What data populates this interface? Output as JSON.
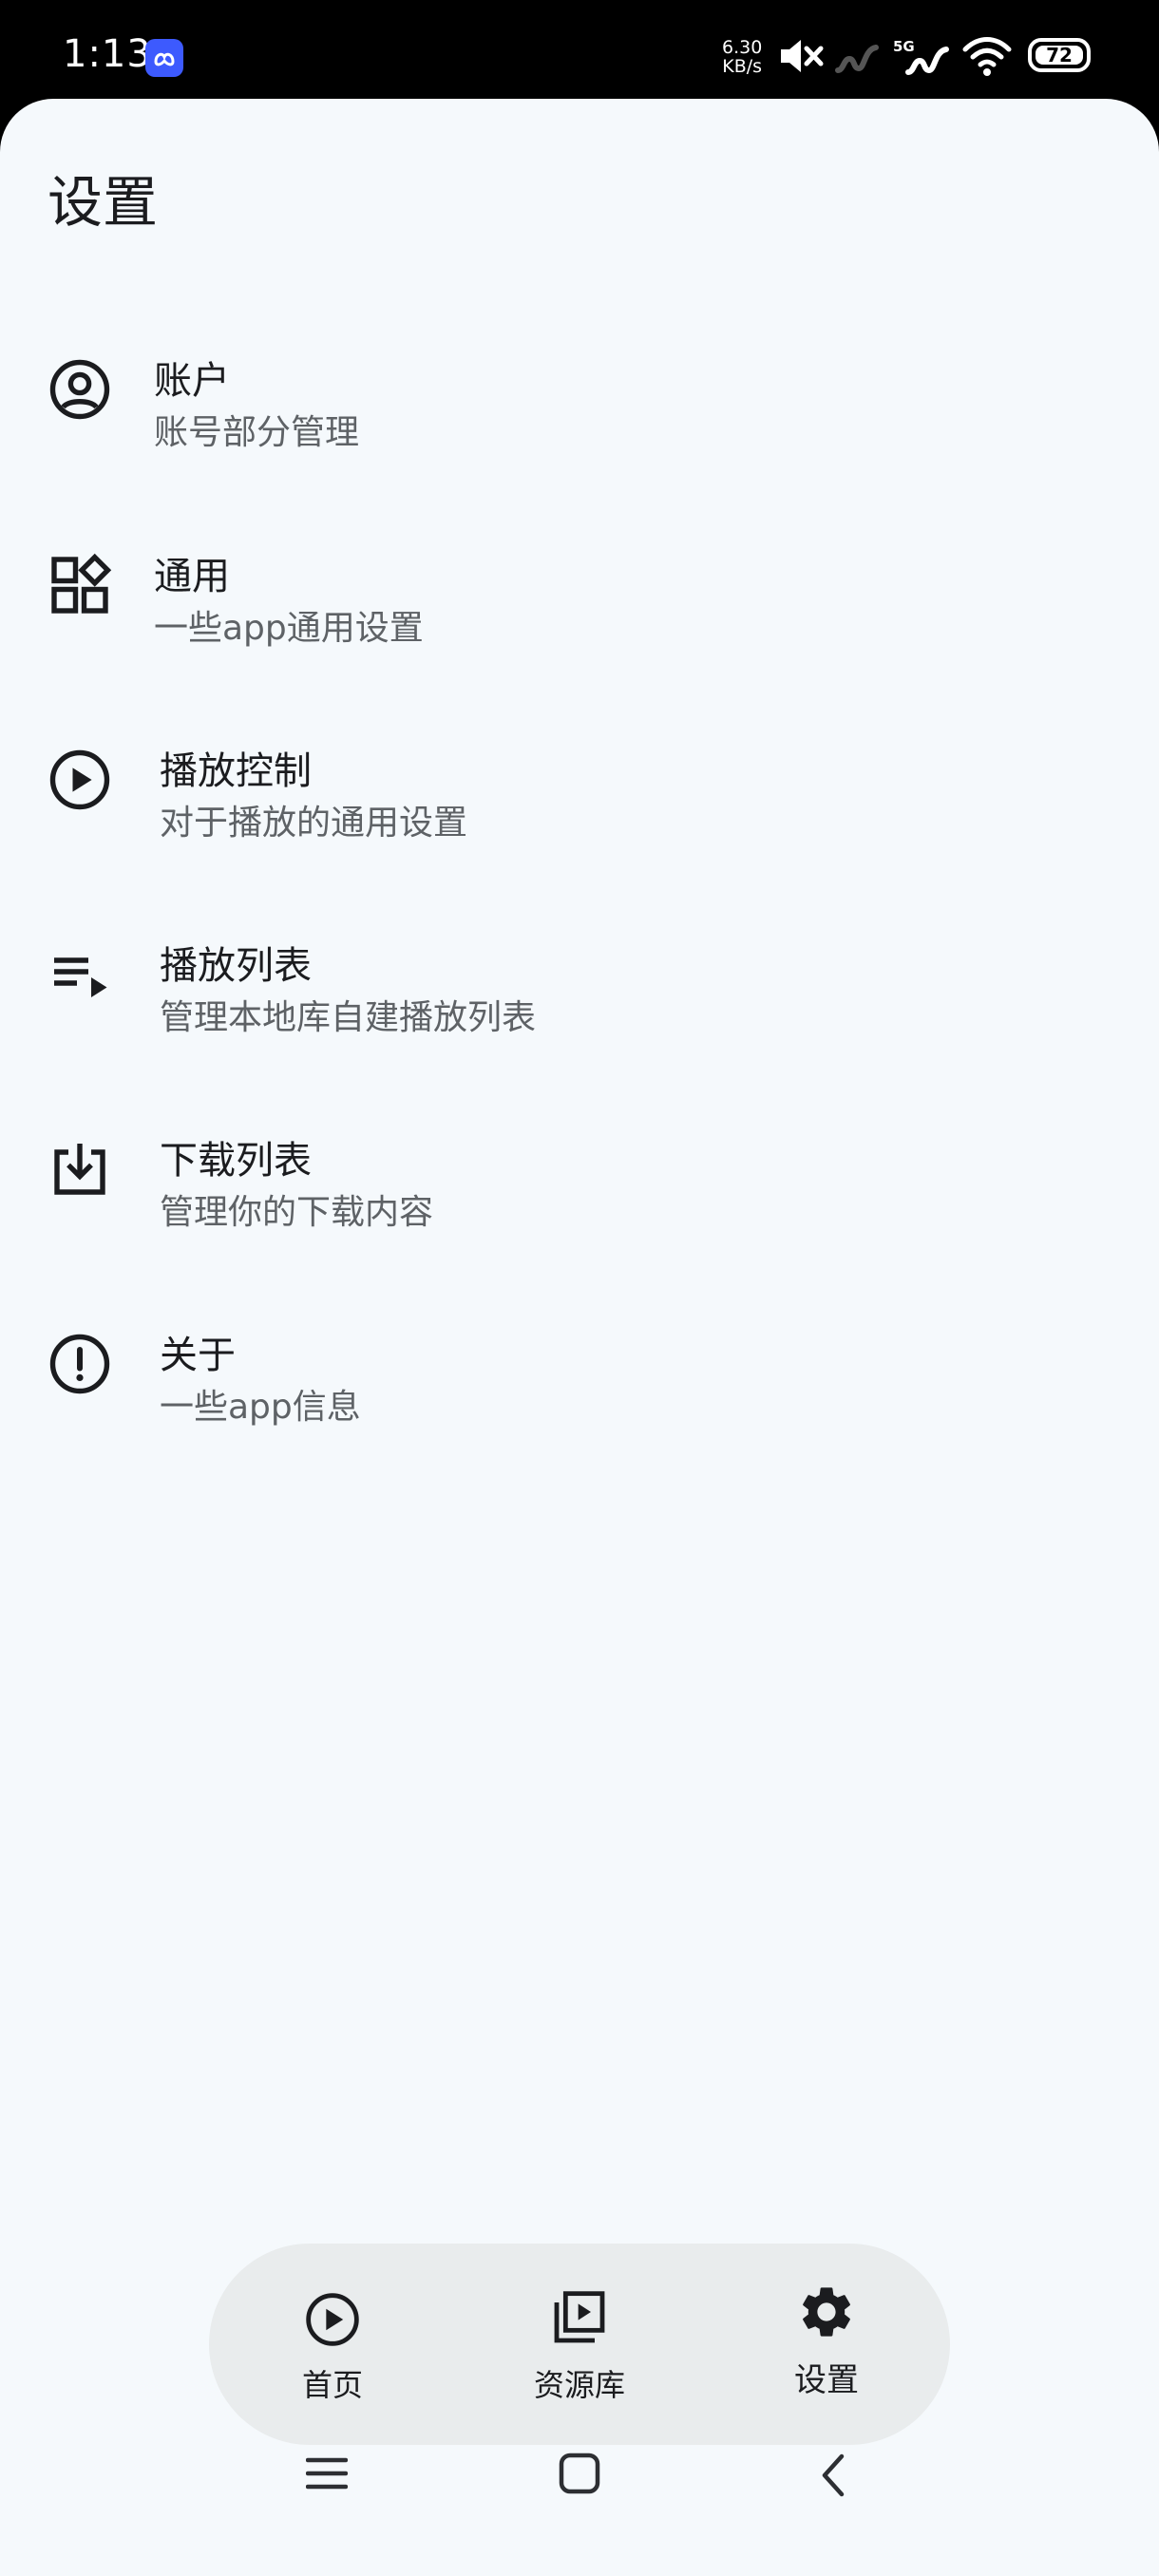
{
  "status_bar": {
    "time": "1:13",
    "speed_value": "6.30",
    "speed_unit": "KB/s",
    "signal_label": "5G",
    "battery": "72"
  },
  "page": {
    "title": "设置"
  },
  "settings": [
    {
      "title": "账户",
      "subtitle": "账号部分管理",
      "icon": "account-circle-icon"
    },
    {
      "title": "通用",
      "subtitle": "一些app通用设置",
      "icon": "widgets-icon"
    },
    {
      "title": "播放控制",
      "subtitle": "对于播放的通用设置",
      "icon": "play-circle-icon"
    },
    {
      "title": "播放列表",
      "subtitle": "管理本地库自建播放列表",
      "icon": "playlist-play-icon"
    },
    {
      "title": "下载列表",
      "subtitle": "管理你的下载内容",
      "icon": "download-box-icon"
    },
    {
      "title": "关于",
      "subtitle": "一些app信息",
      "icon": "info-outline-icon"
    }
  ],
  "bottom_nav": [
    {
      "label": "首页",
      "icon": "play-circle-icon",
      "selected": false
    },
    {
      "label": "资源库",
      "icon": "video-library-icon",
      "selected": false
    },
    {
      "label": "设置",
      "icon": "gear-icon",
      "selected": true
    }
  ],
  "colors": {
    "background": "#f5f9fc",
    "nav_pill": "#e9eced",
    "text_primary": "#1b1c1f",
    "text_secondary": "#5e6266"
  }
}
